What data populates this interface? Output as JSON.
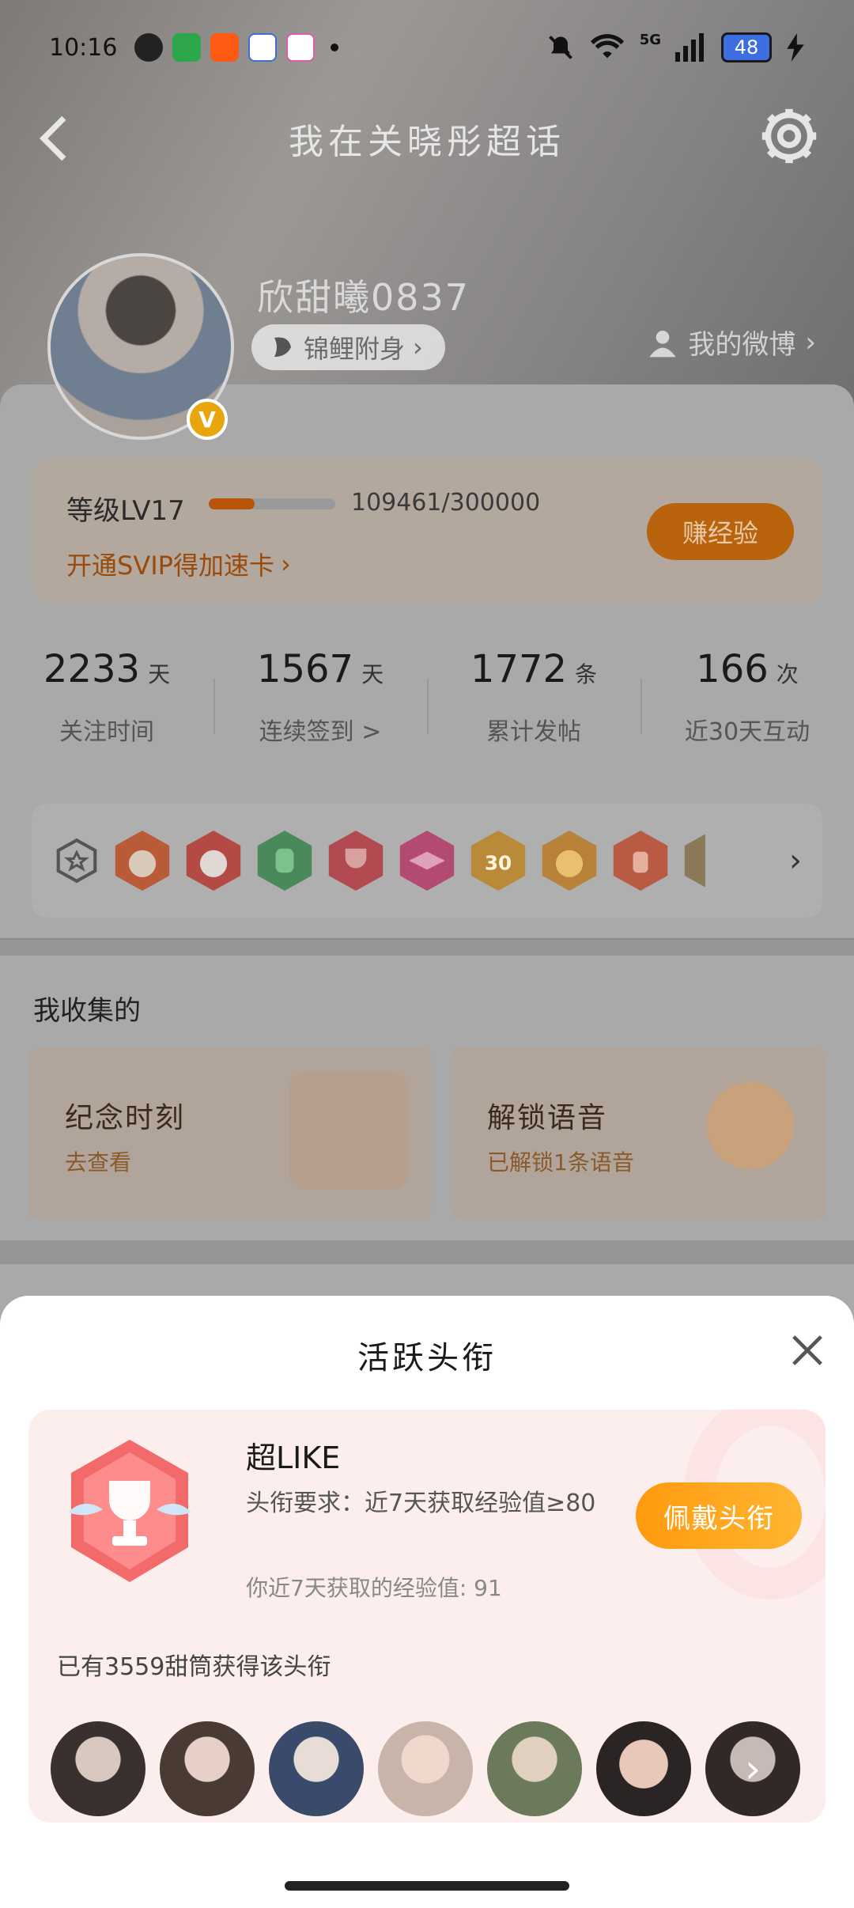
{
  "status_bar": {
    "time": "10:16",
    "battery": "48",
    "network": "5G"
  },
  "nav": {
    "title": "我在关晓彤超话"
  },
  "profile": {
    "username": "欣甜曦0837",
    "koi_label": "锦鲤附身",
    "weibo_link": "我的微博",
    "verified_badge": "V"
  },
  "level": {
    "label": "等级LV17",
    "progress_text": "109461/300000",
    "progress_fraction": 0.365,
    "svip_link": "开通SVIP得加速卡",
    "earn_button": "赚经验"
  },
  "stats": [
    {
      "value": "2233",
      "unit": "天",
      "label": "关注时间"
    },
    {
      "value": "1567",
      "unit": "天",
      "label": "连续签到 >"
    },
    {
      "value": "1772",
      "unit": "条",
      "label": "累计发帖"
    },
    {
      "value": "166",
      "unit": "次",
      "label": "近30天互动"
    }
  ],
  "badges": {
    "items": [
      "rabbit-medal",
      "bunny-medal",
      "hand-medal",
      "trophy-medal",
      "cap-medal",
      "30-days-medal",
      "cheer-medal",
      "rock-medal",
      "partial-medal"
    ],
    "medal_30_text": "30"
  },
  "collection": {
    "title": "我收集的",
    "cards": [
      {
        "title": "纪念时刻",
        "subtitle": "去查看"
      },
      {
        "title": "解锁语音",
        "subtitle": "已解锁1条语音"
      }
    ]
  },
  "sheet": {
    "title": "活跃头衔",
    "title_name": "超LIKE",
    "requirement": "头衔要求：近7天获取经验值≥80",
    "my_exp": "你近7天获取的经验值: 91",
    "wear_button": "佩戴头衔",
    "owners_text": "已有3559甜筒获得该头衔",
    "owner_count_shown": 7
  },
  "colors": {
    "accent_orange": "#ff9a0e",
    "level_fill": "#b8550a",
    "sheet_card_bg": "#fdeeee"
  }
}
